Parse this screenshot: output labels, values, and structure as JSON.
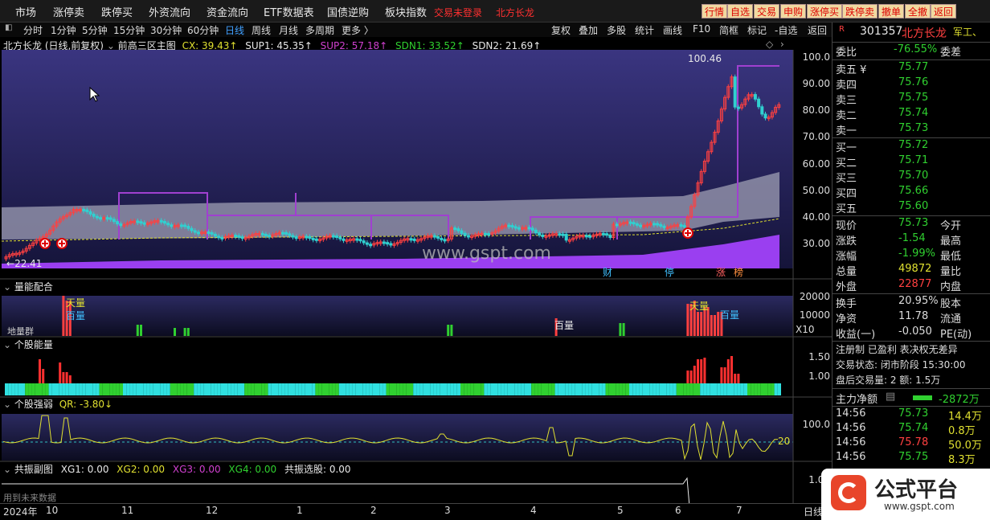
{
  "top_menu": [
    "市场",
    "涨停卖",
    "跌停买",
    "外资流向",
    "资金流向",
    "ETF数据表",
    "国债逆购",
    "板块指数"
  ],
  "login_notice": "交易未登录",
  "stock_name_top": "北方长龙",
  "trade_buttons": [
    "行情",
    "自选",
    "交易",
    "申购",
    "涨停买",
    "跌停卖",
    "撤单",
    "全撤",
    "返回"
  ],
  "periods": [
    "分时",
    "1分钟",
    "5分钟",
    "15分钟",
    "30分钟",
    "60分钟",
    "日线",
    "周线",
    "月线",
    "多周期",
    "更多 〉"
  ],
  "active_period": "日线",
  "right_tools": [
    "复权",
    "叠加",
    "多股",
    "统计",
    "画线",
    "F10",
    "简框",
    "标记",
    "-自选",
    "返回"
  ],
  "main_panel": {
    "title": "北方长龙 (日线,前复权)",
    "indicator_name": "前高三区主图",
    "values": [
      {
        "label": "CX: 39.43↑",
        "color": "#e0e030"
      },
      {
        "label": "SUP1: 45.35↑",
        "color": "#e8e8e8"
      },
      {
        "label": "SUP2: 57.18↑",
        "color": "#d040d0"
      },
      {
        "label": "SDN1: 33.52↑",
        "color": "#30d030"
      },
      {
        "label": "SDN2: 21.69↑",
        "color": "#e8e8e8"
      }
    ],
    "y_labels": [
      "100.0",
      "90.00",
      "80.00",
      "70.00",
      "60.00",
      "50.00",
      "40.00",
      "30.00"
    ],
    "high_mark": "100.46",
    "low_mark": "22.41",
    "watermark": "www.gspt.com",
    "event_tags": [
      "财",
      "停",
      "涨",
      "榜"
    ]
  },
  "vol_panel": {
    "title": "量能配合",
    "y_labels": [
      "20000",
      "10000"
    ],
    "x10": "X10",
    "left_label": "地量群",
    "tags": [
      "天量",
      "百量",
      "百量",
      "天量",
      "百量"
    ]
  },
  "energy_panel": {
    "title": "个股能量",
    "y_labels": [
      "1.50",
      "1.00"
    ]
  },
  "strength_panel": {
    "title": "个股强弱",
    "qr": "QR: -3.80↓",
    "y_labels": [
      "100.0"
    ],
    "level": "20"
  },
  "resonance_panel": {
    "title": "共振副图",
    "values": [
      {
        "label": "XG1: 0.00",
        "color": "#e8e8e8"
      },
      {
        "label": "XG2: 0.00",
        "color": "#e0e030"
      },
      {
        "label": "XG3: 0.00",
        "color": "#d040d0"
      },
      {
        "label": "XG4: 0.00",
        "color": "#30d030"
      },
      {
        "label": "共振选股: 0.00",
        "color": "#e8e8e8"
      }
    ],
    "note": "用到未来数据",
    "y_labels": [
      "1.00"
    ]
  },
  "x_axis": {
    "year": "2024年",
    "months": [
      "10",
      "11",
      "12",
      "1",
      "2",
      "3",
      "4",
      "5",
      "6",
      "7"
    ],
    "period": "日线"
  },
  "quote": {
    "code": "301357",
    "name": "北方长龙",
    "sector": "军工、",
    "weibi": "-76.55%",
    "weicha_label": "委差",
    "asks": [
      {
        "label": "卖五 ¥",
        "price": "75.77"
      },
      {
        "label": "卖四",
        "price": "75.76"
      },
      {
        "label": "卖三",
        "price": "75.75"
      },
      {
        "label": "卖二",
        "price": "75.74"
      },
      {
        "label": "卖一",
        "price": "75.73"
      }
    ],
    "bids": [
      {
        "label": "买一",
        "price": "75.72"
      },
      {
        "label": "买二",
        "price": "75.71"
      },
      {
        "label": "买三",
        "price": "75.70"
      },
      {
        "label": "买四",
        "price": "75.66"
      },
      {
        "label": "买五",
        "price": "75.60"
      }
    ],
    "stats": [
      {
        "l1": "现价",
        "v1": "75.73",
        "c1": "#30d030",
        "l2": "今开"
      },
      {
        "l1": "涨跌",
        "v1": "-1.54",
        "c1": "#30d030",
        "l2": "最高"
      },
      {
        "l1": "涨幅",
        "v1": "-1.99%",
        "c1": "#30d030",
        "l2": "最低"
      },
      {
        "l1": "总量",
        "v1": "49872",
        "c1": "#e0e030",
        "l2": "量比"
      },
      {
        "l1": "外盘",
        "v1": "22877",
        "c1": "#ff4040",
        "l2": "内盘"
      }
    ],
    "stats2": [
      {
        "l1": "换手",
        "v1": "20.95%",
        "l2": "股本"
      },
      {
        "l1": "净资",
        "v1": "11.78",
        "l2": "流通"
      },
      {
        "l1": "收益(一)",
        "v1": "-0.050",
        "l2": "PE(动)"
      }
    ],
    "tags_line": "注册制 已盈利 表决权无差异",
    "status_line": "交易状态: 闭市阶段 15:30:00",
    "after_line": "盘后交易量: 2  额: 1.5万",
    "net_flow_label": "主力净额",
    "net_flow_value": "-2872万",
    "ticks": [
      {
        "time": "14:56",
        "price": "75.73",
        "vol": "14.4万"
      },
      {
        "time": "14:56",
        "price": "75.74",
        "vol": "0.8万"
      },
      {
        "time": "14:56",
        "price": "75.78",
        "vol": "50.0万"
      },
      {
        "time": "14:56",
        "price": "75.75",
        "vol": "8.3万"
      }
    ]
  },
  "logo": {
    "text": "公式平台",
    "url": "www.gspt.com"
  },
  "colors": {
    "up": "#ff4040",
    "down": "#30d030",
    "accent": "#e0e030",
    "purple": "#8a2be2"
  }
}
